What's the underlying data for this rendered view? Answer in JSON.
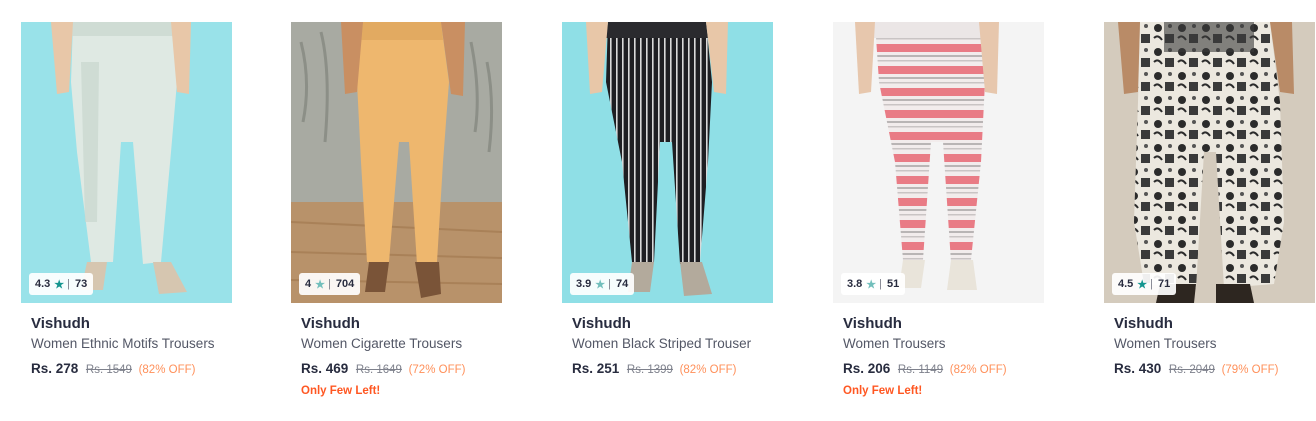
{
  "products": [
    {
      "brand": "Vishudh",
      "name": "Women Ethnic Motifs Trousers",
      "price": "Rs. 278",
      "mrp": "Rs. 1549",
      "discount": "(82% OFF)",
      "rating": "4.3",
      "rating_count": "73",
      "star_color": "#14958f",
      "few_left": ""
    },
    {
      "brand": "Vishudh",
      "name": "Women Cigarette Trousers",
      "price": "Rs. 469",
      "mrp": "Rs. 1649",
      "discount": "(72% OFF)",
      "rating": "4",
      "rating_count": "704",
      "star_color": "#72bfbc",
      "few_left": "Only Few Left!"
    },
    {
      "brand": "Vishudh",
      "name": "Women Black Striped Trouser",
      "price": "Rs. 251",
      "mrp": "Rs. 1399",
      "discount": "(82% OFF)",
      "rating": "3.9",
      "rating_count": "74",
      "star_color": "#72bfbc",
      "few_left": ""
    },
    {
      "brand": "Vishudh",
      "name": "Women Trousers",
      "price": "Rs. 206",
      "mrp": "Rs. 1149",
      "discount": "(82% OFF)",
      "rating": "3.8",
      "rating_count": "51",
      "star_color": "#72bfbc",
      "few_left": "Only Few Left!"
    },
    {
      "brand": "Vishudh",
      "name": "Women Trousers",
      "price": "Rs. 430",
      "mrp": "Rs. 2049",
      "discount": "(79% OFF)",
      "rating": "4.5",
      "rating_count": "71",
      "star_color": "#14958f",
      "few_left": ""
    }
  ],
  "star_glyph": "★",
  "separator": "|"
}
